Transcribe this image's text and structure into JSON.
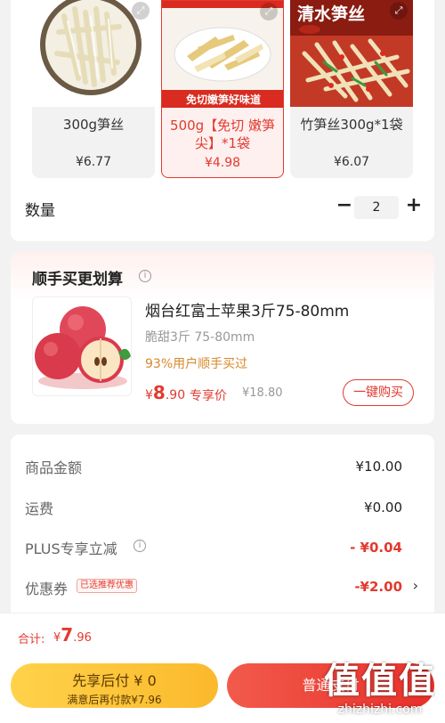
{
  "sku_options": [
    {
      "name": "300g笋丝",
      "price": "¥6.77",
      "selected": false,
      "image_caption": ""
    },
    {
      "name": "500g【免切 嫩笋尖】*1袋",
      "price": "¥4.98",
      "selected": true,
      "image_caption": "免切嫩笋好味道"
    },
    {
      "name": "竹笋丝300g*1袋",
      "price": "¥6.07",
      "selected": false,
      "image_caption": "清水笋丝"
    }
  ],
  "quantity": {
    "label": "数量",
    "minus": "−",
    "value": "2",
    "plus": "+"
  },
  "upsell": {
    "title": "顺手买更划算",
    "product_name": "烟台红富士苹果3斤75-80mm",
    "subtitle": "脆甜3斤 75-80mm",
    "hint": "93%用户顺手买过",
    "price_symbol": "¥",
    "price_int": "8",
    "price_dec": ".90",
    "exclusive_tag": "专享价",
    "original_price": "¥18.80",
    "buy_button": "一键购买"
  },
  "summary": {
    "goods_label": "商品金额",
    "goods_value": "¥10.00",
    "shipping_label": "运费",
    "shipping_value": "¥0.00",
    "plus_label": "PLUS专享立减",
    "plus_value": "- ¥0.04",
    "coupon_label": "优惠券",
    "coupon_badge": "已选推荐优惠",
    "coupon_value": "-¥2.00"
  },
  "bottom": {
    "total_label": "合计:",
    "total_symbol": "¥",
    "total_int": "7",
    "total_dec": ".96",
    "pay_later_line1": "先享后付 ¥ 0",
    "pay_later_line2": "满意后再付款¥7.96",
    "pay_now": "普通支付"
  },
  "watermark": {
    "line1": "值值值",
    "line2": "zhizhizhi.com"
  },
  "colors": {
    "accent": "#e23a2e",
    "pay_later": "#fbc33a",
    "hint": "#d7892b"
  }
}
